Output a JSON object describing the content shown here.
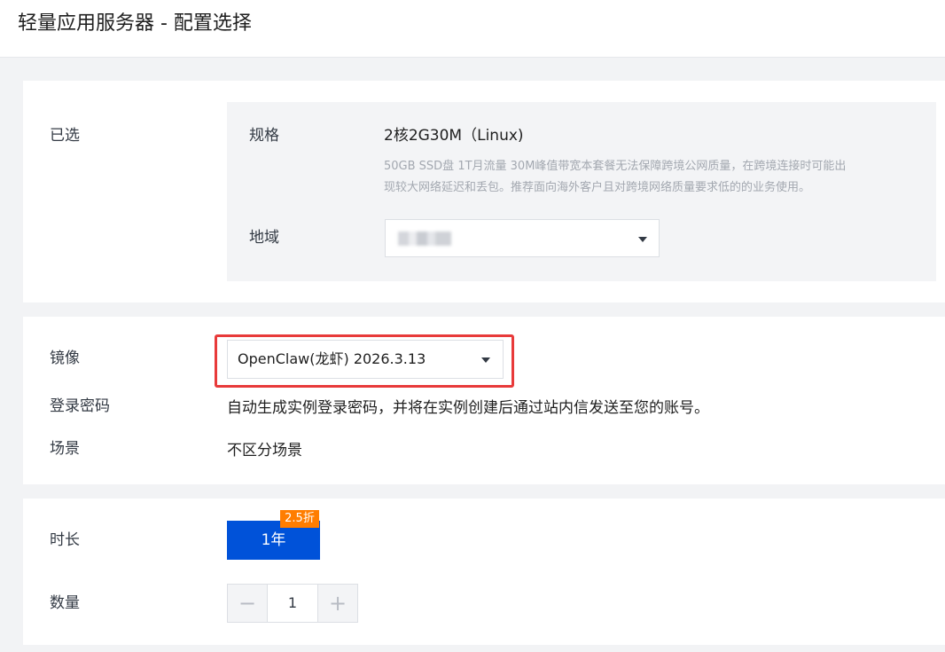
{
  "header": {
    "title": "轻量应用服务器 - 配置选择"
  },
  "selected": {
    "label": "已选",
    "spec_label": "规格",
    "spec_name": "2核2G30M（Linux)",
    "spec_desc_line1": "50GB SSD盘 1T月流量 30M峰值带宽本套餐无法保障跨境公网质量，在跨境连接时可能出",
    "spec_desc_line2": "现较大网络延迟和丢包。推荐面向海外客户且对跨境网络质量要求低的的业务使用。",
    "region_label": "地域",
    "region_value_blurred": true
  },
  "image": {
    "label": "镜像",
    "value": "OpenClaw(龙虾) 2026.3.13",
    "password_label": "登录密码",
    "password_text": "自动生成实例登录密码，并将在实例创建后通过站内信发送至您的账号。",
    "scene_label": "场景",
    "scene_value": "不区分场景"
  },
  "purchase": {
    "duration_label": "时长",
    "duration_value": "1年",
    "discount_badge": "2.5折",
    "quantity_label": "数量",
    "quantity_value": "1",
    "minus_glyph": "−",
    "plus_glyph": "+"
  },
  "colors": {
    "primary": "#0052d9",
    "badge": "#ff7d00",
    "highlight": "#e83a3a"
  }
}
